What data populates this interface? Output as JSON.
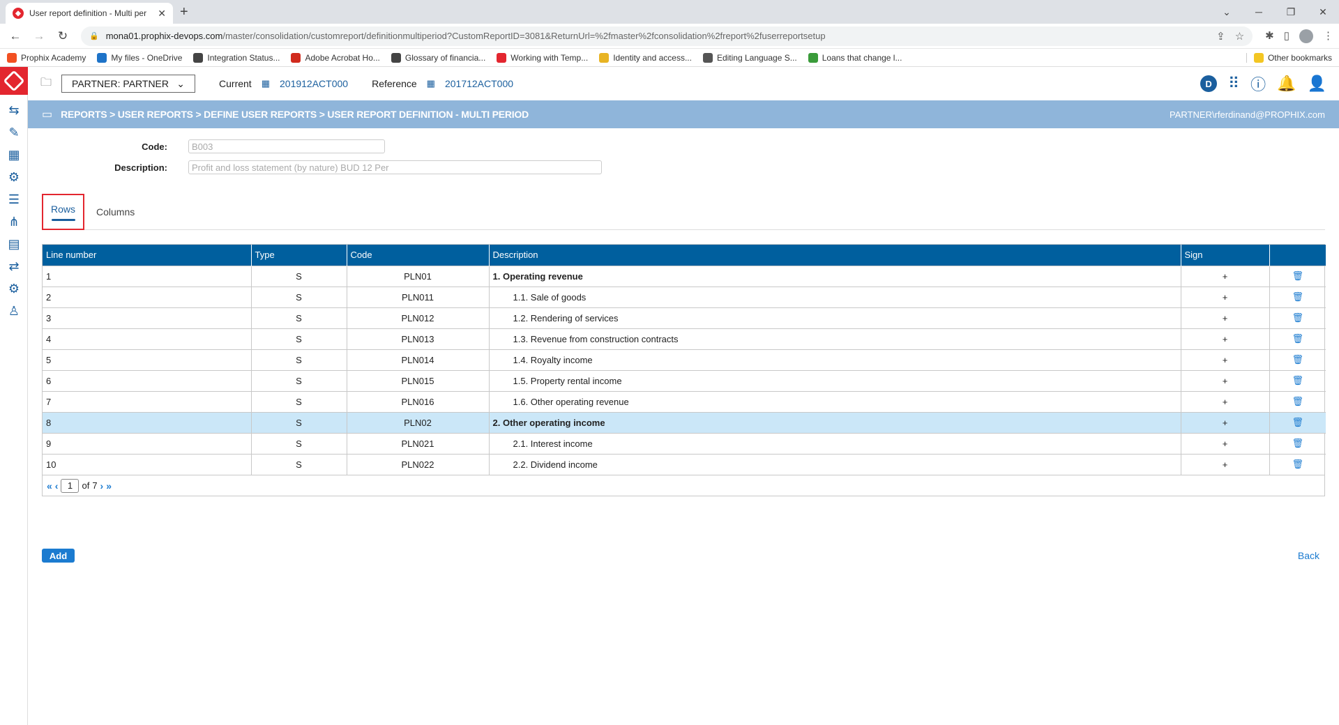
{
  "browser": {
    "tab_title": "User report definition - Multi per",
    "url_host": "mona01.prophix-devops.com",
    "url_path": "/master/consolidation/customreport/definitionmultiperiod?CustomReportID=3081&ReturnUrl=%2fmaster%2fconsolidation%2freport%2fuserreportsetup",
    "bookmarks": [
      {
        "label": "Prophix Academy",
        "color": "#f25022"
      },
      {
        "label": "My files - OneDrive",
        "color": "#1e73c8"
      },
      {
        "label": "Integration Status...",
        "color": "#444444"
      },
      {
        "label": "Adobe Acrobat Ho...",
        "color": "#d12b1e"
      },
      {
        "label": "Glossary of financia...",
        "color": "#444444"
      },
      {
        "label": "Working with Temp...",
        "color": "#e3262f"
      },
      {
        "label": "Identity and access...",
        "color": "#e8b424"
      },
      {
        "label": "Editing Language S...",
        "color": "#555555"
      },
      {
        "label": "Loans that change l...",
        "color": "#3a9b3a"
      }
    ],
    "other_bookmarks": "Other bookmarks"
  },
  "appbar": {
    "entity": "PARTNER: PARTNER",
    "current_label": "Current",
    "current_value": "201912ACT000",
    "reference_label": "Reference",
    "reference_value": "201712ACT000",
    "badge": "D"
  },
  "breadcrumb": {
    "path": "REPORTS > USER REPORTS > DEFINE USER REPORTS > USER REPORT DEFINITION - MULTI PERIOD",
    "user": "PARTNER\\rferdinand@PROPHIX.com"
  },
  "form": {
    "code_label": "Code:",
    "code_value": "B003",
    "description_label": "Description:",
    "description_value": "Profit and loss statement (by nature)  BUD 12 Per"
  },
  "tabs": {
    "rows": "Rows",
    "columns": "Columns"
  },
  "grid": {
    "headers": [
      "Line number",
      "Type",
      "Code",
      "Description",
      "Sign",
      ""
    ],
    "rows": [
      {
        "line": "1",
        "type": "S",
        "code": "PLN01",
        "desc": "1. Operating revenue",
        "sign": "+",
        "bold": true
      },
      {
        "line": "2",
        "type": "S",
        "code": "PLN011",
        "desc": "1.1. Sale of goods",
        "sign": "+",
        "bold": false
      },
      {
        "line": "3",
        "type": "S",
        "code": "PLN012",
        "desc": "1.2. Rendering of services",
        "sign": "+",
        "bold": false
      },
      {
        "line": "4",
        "type": "S",
        "code": "PLN013",
        "desc": "1.3. Revenue from construction contracts",
        "sign": "+",
        "bold": false
      },
      {
        "line": "5",
        "type": "S",
        "code": "PLN014",
        "desc": "1.4. Royalty income",
        "sign": "+",
        "bold": false
      },
      {
        "line": "6",
        "type": "S",
        "code": "PLN015",
        "desc": "1.5. Property rental income",
        "sign": "+",
        "bold": false
      },
      {
        "line": "7",
        "type": "S",
        "code": "PLN016",
        "desc": "1.6. Other operating revenue",
        "sign": "+",
        "bold": false
      },
      {
        "line": "8",
        "type": "S",
        "code": "PLN02",
        "desc": "2. Other operating income",
        "sign": "+",
        "bold": true,
        "selected": true
      },
      {
        "line": "9",
        "type": "S",
        "code": "PLN021",
        "desc": "2.1. Interest income",
        "sign": "+",
        "bold": false
      },
      {
        "line": "10",
        "type": "S",
        "code": "PLN022",
        "desc": "2.2. Dividend income",
        "sign": "+",
        "bold": false
      }
    ],
    "pager": {
      "current_page": "1",
      "of_label": "of",
      "total_pages": "7"
    }
  },
  "actions": {
    "add": "Add",
    "back": "Back"
  }
}
